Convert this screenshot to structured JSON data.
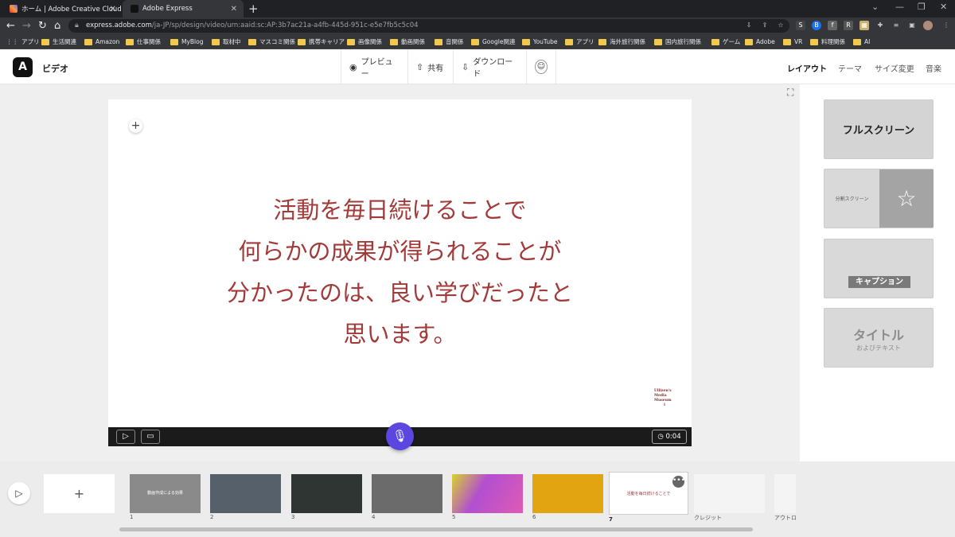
{
  "browser": {
    "tabs": [
      {
        "title": "ホーム | Adobe Creative Cloud"
      },
      {
        "title": "Adobe Express"
      }
    ],
    "url_host": "express.adobe.com",
    "url_path": "/ja-JP/sp/design/video/urn:aaid:sc:AP:3b7ac21a-a4fb-445d-951c-e5e7fb5c5c04",
    "new_tab_glyph": "+",
    "back_glyph": "←",
    "forward_glyph": "→",
    "reload_glyph": "↻",
    "home_glyph": "⌂",
    "bookmarks": [
      "アプリ",
      "生活関連",
      "Amazon",
      "仕事関係",
      "MyBlog",
      "取材中",
      "マスコミ関係",
      "携帯キャリア",
      "画像関係",
      "動画関係",
      "音関係",
      "Google関連",
      "YouTube",
      "アプリ",
      "海外旅行関係",
      "国内旅行関係",
      "ゲーム",
      "Adobe",
      "VR",
      "料理関係",
      "AI"
    ]
  },
  "app": {
    "logo": "A",
    "doc_title": "ビデオ",
    "header_buttons": {
      "preview": "プレビュー",
      "share": "共有",
      "download": "ダウンロード"
    },
    "right_tabs": [
      "レイアウト",
      "テーマ",
      "サイズ変更",
      "音楽"
    ],
    "active_tab": "レイアウト"
  },
  "canvas": {
    "add_glyph": "+",
    "caption_lines": [
      "活動を毎日続けることで",
      "何らかの成果が得られることが",
      "分かったのは、良い学びだったと",
      "思います。"
    ],
    "caption_color": "#a33a3a",
    "watermark": [
      "Ullizen's",
      "Media",
      "Museum",
      "i"
    ],
    "duration": "0:04",
    "mic_color": "#5b46e0"
  },
  "layouts": {
    "full": "フルスクリーン",
    "split": "分割スクリーン",
    "caption": "キャプション",
    "title": "タイトル",
    "title_sub": "およびテキスト"
  },
  "timeline": {
    "add_glyph": "+",
    "scenes": [
      {
        "num": "1",
        "text": "動画作成による効果",
        "bg": "#8a8a8a"
      },
      {
        "num": "2",
        "text": "",
        "bg": "#56606a"
      },
      {
        "num": "3",
        "text": "",
        "bg": "#2f3533"
      },
      {
        "num": "4",
        "text": "",
        "bg": "#6b6b6b"
      },
      {
        "num": "5",
        "text": "",
        "bg": "#b24fd0"
      },
      {
        "num": "6",
        "text": "",
        "bg": "#e3a412"
      },
      {
        "num": "7",
        "text": "活動を毎日続けることで",
        "bg": "#ffffff"
      },
      {
        "num": "クレジット",
        "text": "",
        "bg": "#f4f4f4"
      },
      {
        "num": "アウトロ",
        "text": "",
        "bg": "#f4f4f4"
      }
    ],
    "more_glyph": "•••"
  }
}
